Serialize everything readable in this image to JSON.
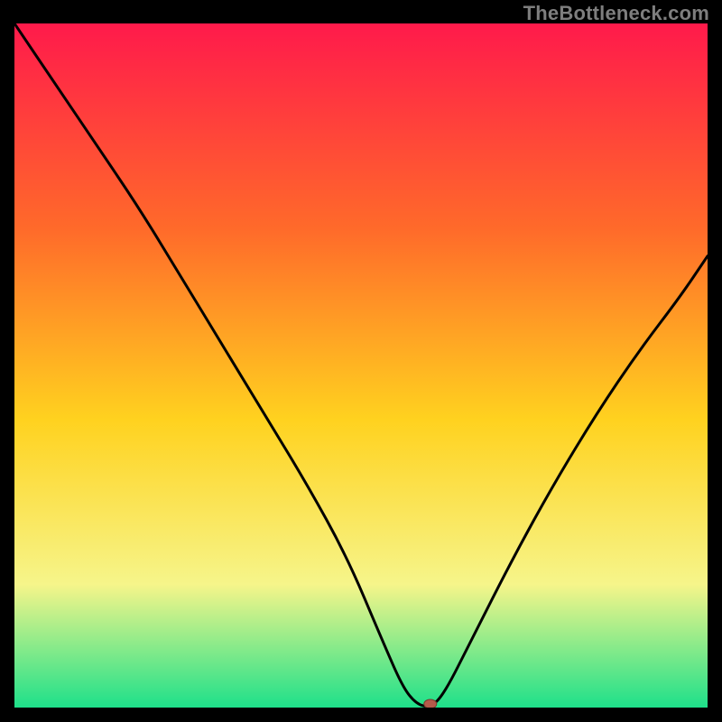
{
  "watermark": "TheBottleneck.com",
  "colors": {
    "frame_bg": "#000000",
    "gradient_top": "#ff1a4b",
    "gradient_mid1": "#ff6a2a",
    "gradient_mid2": "#ffd21f",
    "gradient_mid3": "#f6f58a",
    "gradient_bottom": "#1ee08a",
    "curve": "#000000",
    "marker_fill": "#b55a4a",
    "marker_stroke": "#7a3a2e"
  },
  "chart_data": {
    "type": "line",
    "title": "",
    "xlabel": "",
    "ylabel": "",
    "xlim": [
      0,
      100
    ],
    "ylim": [
      0,
      100
    ],
    "x": [
      0,
      6,
      12,
      18,
      24,
      30,
      36,
      42,
      48,
      53,
      56,
      58,
      60,
      62,
      66,
      72,
      78,
      84,
      90,
      96,
      100
    ],
    "values": [
      100,
      91,
      82,
      73,
      63,
      53,
      43,
      33,
      22,
      10,
      3,
      0.5,
      0,
      2,
      10,
      22,
      33,
      43,
      52,
      60,
      66
    ],
    "marker": {
      "x": 60,
      "y": 0
    },
    "annotations": []
  }
}
